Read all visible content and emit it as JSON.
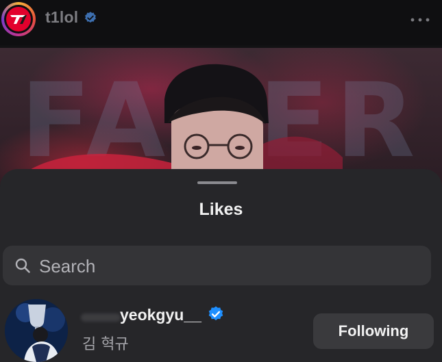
{
  "post_header": {
    "username": "t1lol",
    "avatar_icon": "t1-logo-icon",
    "verified_icon": "verified-badge-icon",
    "more_icon": "more-options-icon"
  },
  "post_image": {
    "background_word": "FAKER"
  },
  "likes_sheet": {
    "title": "Likes",
    "search": {
      "placeholder": "Search",
      "icon": "search-icon"
    },
    "users": [
      {
        "username": "yeokgyu__",
        "full_name": "김 혁규",
        "verified": true,
        "button_label": "Following"
      }
    ]
  },
  "colors": {
    "verified_blue": "#1e8fff",
    "sheet_bg": "#262629",
    "t1_red": "#e2012d"
  }
}
